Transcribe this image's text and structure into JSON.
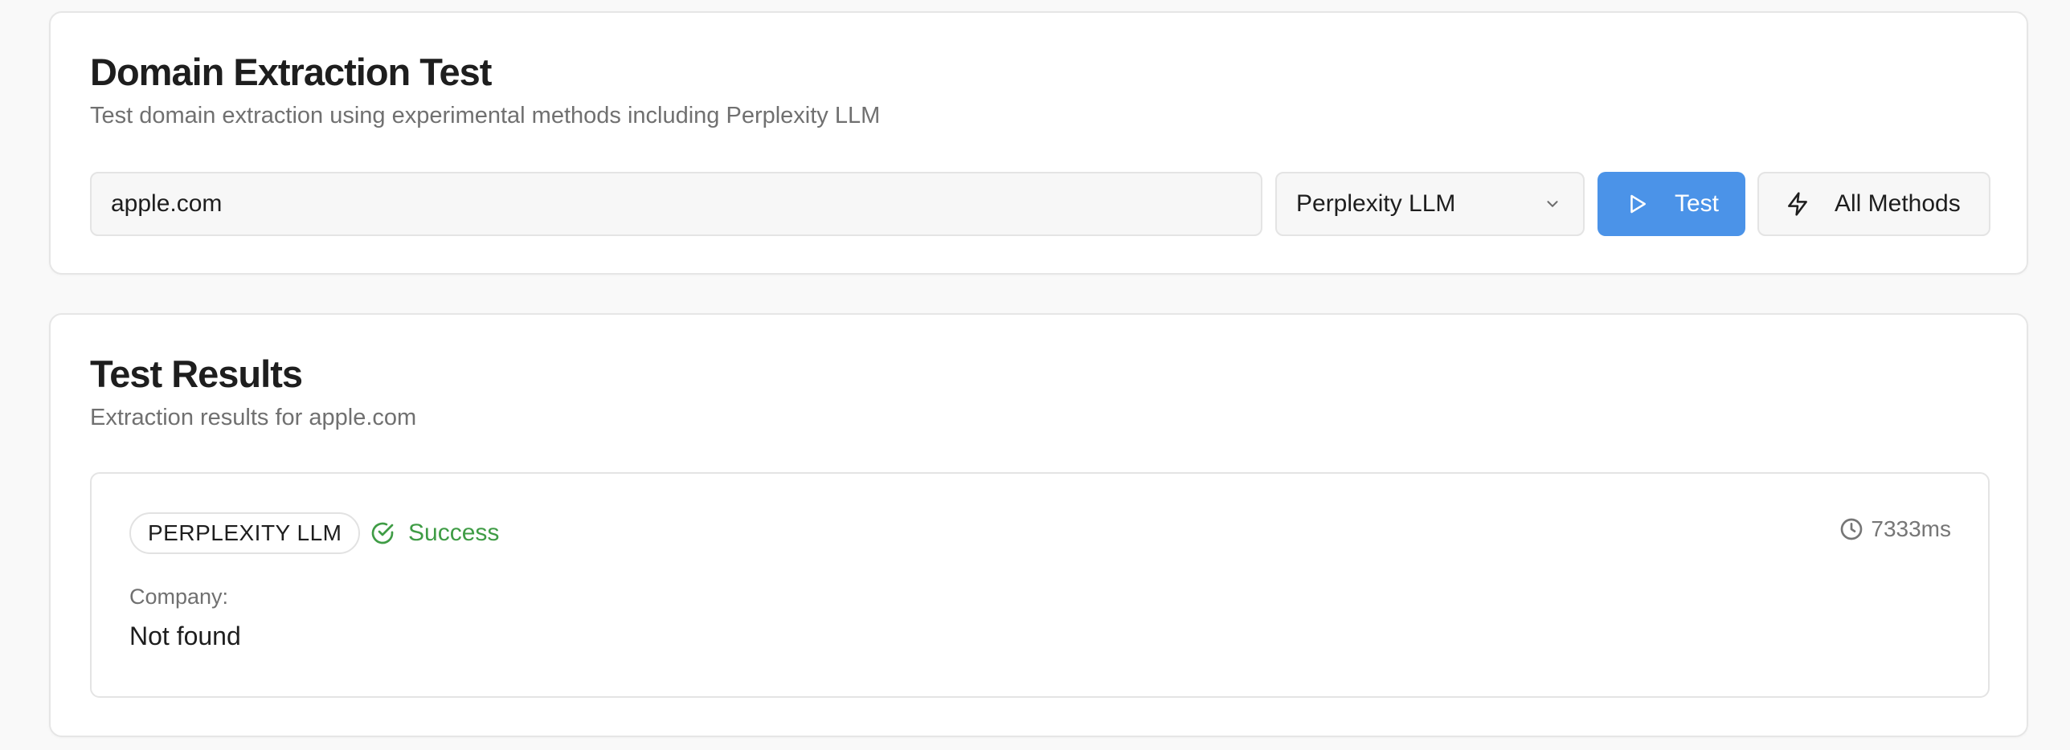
{
  "extraction_test": {
    "title": "Domain Extraction Test",
    "subtitle": "Test domain extraction using experimental methods including Perplexity LLM",
    "domain_input_value": "apple.com",
    "method_select": {
      "selected": "Perplexity LLM",
      "icon": "chevron-down-icon"
    },
    "test_button": {
      "label": "Test",
      "icon": "play-icon",
      "color": "#4b93e8"
    },
    "all_methods_button": {
      "label": "All Methods",
      "icon": "lightning-bolt-icon"
    }
  },
  "results": {
    "title": "Test Results",
    "subtitle": "Extraction results for apple.com",
    "items": [
      {
        "method": "PERPLEXITY LLM",
        "status": "Success",
        "status_icon": "check-circle-icon",
        "status_color": "#3f9c45",
        "duration": "7333ms",
        "duration_icon": "clock-icon",
        "fields": [
          {
            "label": "Company:",
            "value": "Not found"
          }
        ]
      }
    ]
  }
}
